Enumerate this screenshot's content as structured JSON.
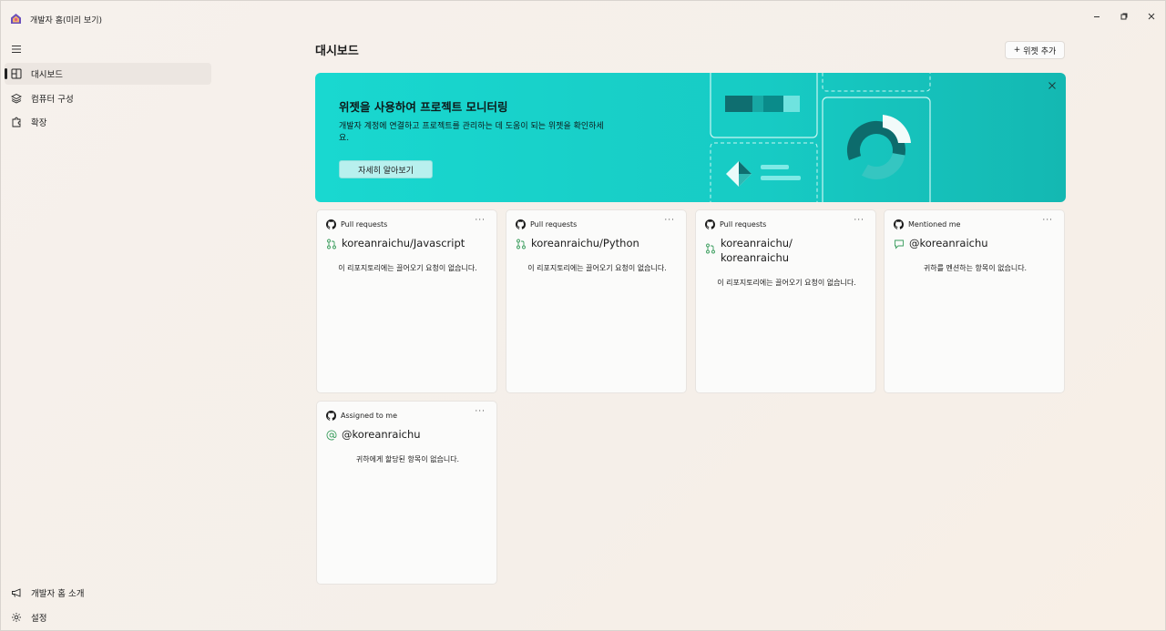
{
  "app": {
    "title": "개발자 홈(미리 보기)",
    "window_controls": [
      "minimize",
      "restore",
      "close"
    ]
  },
  "sidebar": {
    "items": [
      {
        "label": "대시보드",
        "icon": "dashboard-icon",
        "active": true
      },
      {
        "label": "컴퓨터 구성",
        "icon": "layers-icon",
        "active": false
      },
      {
        "label": "확장",
        "icon": "puzzle-icon",
        "active": false
      }
    ],
    "bottom_items": [
      {
        "label": "개발자 홈 소개",
        "icon": "megaphone-icon"
      },
      {
        "label": "설정",
        "icon": "gear-icon"
      }
    ]
  },
  "main": {
    "title": "대시보드",
    "add_widget_label": "위젯 추가"
  },
  "banner": {
    "title": "위젯을 사용하여 프로젝트 모니터링",
    "description": "개발자 계정에 연결하고 프로젝트를 관리하는 데 도움이 되는 위젯을 확인하세요.",
    "button_label": "자세히 알아보기"
  },
  "widgets": [
    {
      "header": "Pull requests",
      "title": "koreanraichu/Javascript",
      "icon": "pull-request-icon",
      "empty_text": "이 리포지토리에는 끌어오기 요청이 없습니다."
    },
    {
      "header": "Pull requests",
      "title": "koreanraichu/Python",
      "icon": "pull-request-icon",
      "empty_text": "이 리포지토리에는 끌어오기 요청이 없습니다."
    },
    {
      "header": "Pull requests",
      "title": "koreanraichu/ koreanraichu",
      "icon": "pull-request-icon",
      "empty_text": "이 리포지토리에는 끌어오기 요청이 없습니다."
    },
    {
      "header": "Mentioned me",
      "title": "@koreanraichu",
      "icon": "comment-icon",
      "empty_text": "귀하를 멘션하는 항목이 없습니다."
    },
    {
      "header": "Assigned to me",
      "title": "@koreanraichu",
      "icon": "at-icon",
      "empty_text": "귀하에게 할당된 항목이 없습니다."
    }
  ],
  "colors": {
    "banner": "#17cbc4",
    "accent_green": "#3a9d5d"
  }
}
